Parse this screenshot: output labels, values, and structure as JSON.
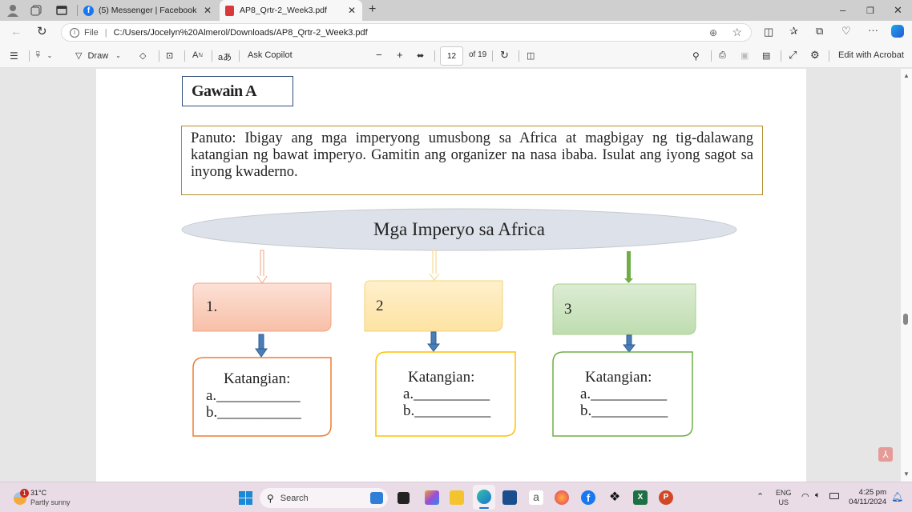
{
  "browser": {
    "tabs": [
      {
        "label": "(5) Messenger | Facebook",
        "icon": "facebook-icon",
        "active": false
      },
      {
        "label": "AP8_Qrtr-2_Week3.pdf",
        "icon": "pdf-icon",
        "active": true
      }
    ],
    "address": {
      "scheme_label": "File",
      "url": "C:/Users/Jocelyn%20Almerol/Downloads/AP8_Qrtr-2_Week3.pdf"
    }
  },
  "pdf_toolbar": {
    "draw_label": "Draw",
    "ask_copilot_label": "Ask Copilot",
    "page_current": "12",
    "page_total_label": "of 19",
    "edit_acrobat_label": "Edit with Acrobat"
  },
  "document": {
    "activity_title": "Gawain A",
    "instructions": "Panuto: Ibigay ang mga imperyong umusbong sa Africa at magbigay ng tig-dalawang katangian ng bawat imperyo. Gamitin ang organizer na nasa ibaba. Isulat ang iyong sagot sa inyong kwaderno.",
    "organizer_title": "Mga Imperyo sa Africa",
    "columns": [
      {
        "number": "1.",
        "fill": "#f9c9b6",
        "border": "#ed7d31",
        "characteristics_label": "Katangian:",
        "a": "a.___________",
        "b": "b.___________"
      },
      {
        "number": "2",
        "fill": "#fde9b8",
        "border": "#ffc000",
        "characteristics_label": "Katangian:",
        "a": "a.__________",
        "b": "b.__________"
      },
      {
        "number": "3",
        "fill": "#c9e2bc",
        "border": "#70ad47",
        "characteristics_label": "Katangian:",
        "a": "a.__________",
        "b": "b.__________"
      }
    ]
  },
  "taskbar": {
    "weather_temp": "31°C",
    "weather_desc": "Partly sunny",
    "weather_badge": "1",
    "search_placeholder": "Search",
    "lang_top": "ENG",
    "lang_bottom": "US",
    "time": "4:25 pm",
    "date": "04/11/2024"
  }
}
